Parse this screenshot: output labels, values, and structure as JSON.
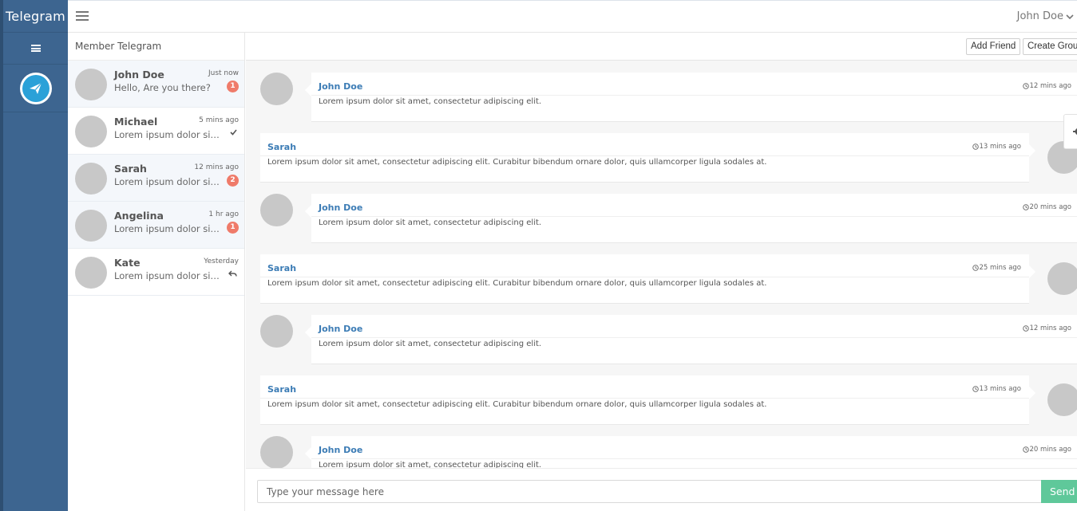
{
  "app": {
    "title": "Telegram"
  },
  "topbar": {
    "user_name": "John Doe"
  },
  "contacts": {
    "title": "Member Telegram",
    "items": [
      {
        "name": "John Doe",
        "time": "Just now",
        "message": "Hello, Are you there?",
        "badge": "1",
        "status_icon": ""
      },
      {
        "name": "Michael",
        "time": "5 mins ago",
        "message": "Lorem ipsum dolor sit amet, consectetur",
        "badge": "",
        "status_icon": "check-icon"
      },
      {
        "name": "Sarah",
        "time": "12 mins ago",
        "message": "Lorem ipsum dolor sit amet, consectetur",
        "badge": "2",
        "status_icon": ""
      },
      {
        "name": "Angelina",
        "time": "1 hr ago",
        "message": "Lorem ipsum dolor sit amet, consectetur",
        "badge": "1",
        "status_icon": ""
      },
      {
        "name": "Kate",
        "time": "Yesterday",
        "message": "Lorem ipsum dolor sit amet, consectetur",
        "badge": "",
        "status_icon": "reply-icon"
      }
    ]
  },
  "toolbar": {
    "add_friend_label": "Add Friend",
    "create_group_label": "Create Group"
  },
  "messages": [
    {
      "side": "left",
      "name": "John Doe",
      "time": "12 mins ago",
      "text": "Lorem ipsum dolor sit amet, consectetur adipiscing elit."
    },
    {
      "side": "right",
      "name": "Sarah",
      "time": "13 mins ago",
      "text": "Lorem ipsum dolor sit amet, consectetur adipiscing elit. Curabitur bibendum ornare dolor, quis ullamcorper ligula sodales at."
    },
    {
      "side": "left",
      "name": "John Doe",
      "time": "20 mins ago",
      "text": "Lorem ipsum dolor sit amet, consectetur adipiscing elit."
    },
    {
      "side": "right",
      "name": "Sarah",
      "time": "25 mins ago",
      "text": "Lorem ipsum dolor sit amet, consectetur adipiscing elit. Curabitur bibendum ornare dolor, quis ullamcorper ligula sodales at."
    },
    {
      "side": "left",
      "name": "John Doe",
      "time": "12 mins ago",
      "text": "Lorem ipsum dolor sit amet, consectetur adipiscing elit."
    },
    {
      "side": "right",
      "name": "Sarah",
      "time": "13 mins ago",
      "text": "Lorem ipsum dolor sit amet, consectetur adipiscing elit. Curabitur bibendum ornare dolor, quis ullamcorper ligula sodales at."
    },
    {
      "side": "left",
      "name": "John Doe",
      "time": "20 mins ago",
      "text": "Lorem ipsum dolor sit amet, consectetur adipiscing elit."
    }
  ],
  "composer": {
    "placeholder": "Type your message here",
    "send_label": "Send"
  },
  "colors": {
    "sidebar": "#3d6590",
    "accent_name": "#3c7cb5",
    "badge": "#ef7b6a",
    "send": "#5fc89a",
    "logo": "#2aa1d8"
  }
}
